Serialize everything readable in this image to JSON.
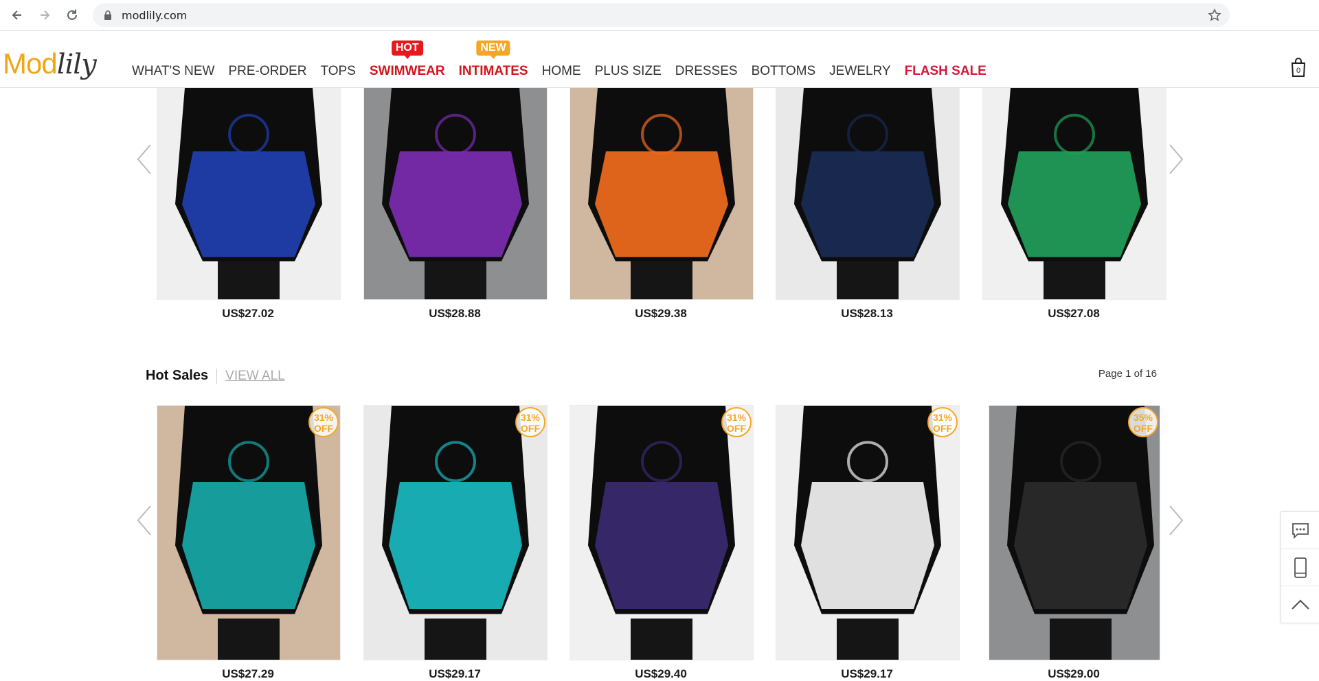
{
  "browser": {
    "url": "modlily.com"
  },
  "header": {
    "logo_mod": "Mod",
    "logo_lily": "lily",
    "cart_count": "0",
    "nav": [
      {
        "label": "WHAT'S NEW",
        "style": "normal",
        "badge": ""
      },
      {
        "label": "PRE-ORDER",
        "style": "normal",
        "badge": ""
      },
      {
        "label": "TOPS",
        "style": "normal",
        "badge": ""
      },
      {
        "label": "SWIMWEAR",
        "style": "red",
        "badge": "HOT"
      },
      {
        "label": "INTIMATES",
        "style": "red",
        "badge": "NEW"
      },
      {
        "label": "HOME",
        "style": "normal",
        "badge": ""
      },
      {
        "label": "PLUS SIZE",
        "style": "normal",
        "badge": ""
      },
      {
        "label": "DRESSES",
        "style": "normal",
        "badge": ""
      },
      {
        "label": "BOTTOMS",
        "style": "normal",
        "badge": ""
      },
      {
        "label": "JEWELRY",
        "style": "normal",
        "badge": ""
      },
      {
        "label": "FLASH SALE",
        "style": "flash",
        "badge": ""
      }
    ]
  },
  "top_row": {
    "products": [
      {
        "price": "US$27.02",
        "color": "#1f3fb0"
      },
      {
        "price": "US$28.88",
        "color": "#7b2bb0"
      },
      {
        "price": "US$29.38",
        "color": "#f06a1c"
      },
      {
        "price": "US$28.13",
        "color": "#1a2a55"
      },
      {
        "price": "US$27.08",
        "color": "#1f9e5a"
      }
    ]
  },
  "hot_sales": {
    "title": "Hot Sales",
    "view_all": "VIEW ALL",
    "page_info": "Page 1 of 16",
    "products": [
      {
        "price": "US$27.29",
        "discount_pct": "31%",
        "discount_word": "OFF",
        "color": "#18a8a8"
      },
      {
        "price": "US$29.17",
        "discount_pct": "31%",
        "discount_word": "OFF",
        "color": "#19b8c0"
      },
      {
        "price": "US$29.40",
        "discount_pct": "31%",
        "discount_word": "OFF",
        "color": "#3a2a70"
      },
      {
        "price": "US$29.17",
        "discount_pct": "31%",
        "discount_word": "OFF",
        "color": "#f2f2f2"
      },
      {
        "price": "US$29.00",
        "discount_pct": "35%",
        "discount_word": "OFF",
        "color": "#2a2a2a"
      }
    ]
  },
  "colors": {
    "accent_orange": "#f5a623",
    "hot_red": "#e8191d",
    "flash_red": "#d1193b"
  }
}
